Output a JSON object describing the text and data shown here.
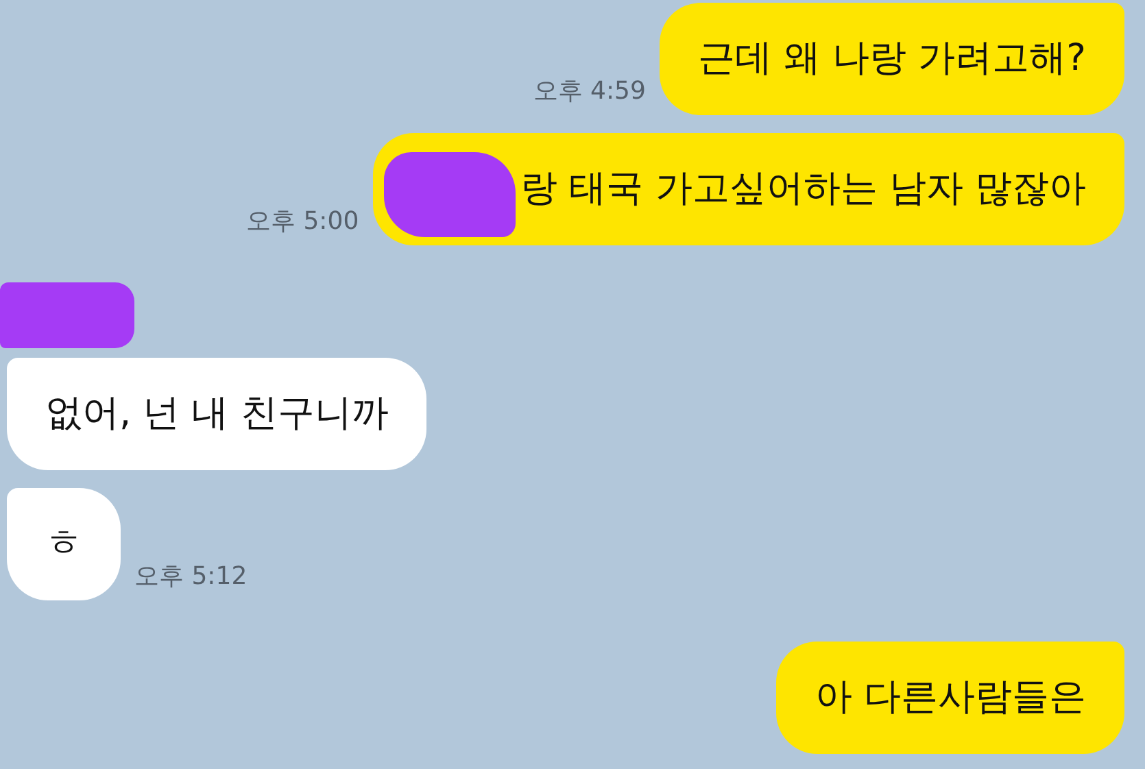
{
  "messages": [
    {
      "kind": "outgoing",
      "text": "근데 왜 나랑 가려고해?",
      "time": "오후 4:59"
    },
    {
      "kind": "outgoing",
      "text": "랑 태국 가고싶어하는 남자 많잖아",
      "time": "오후 5:00",
      "redacted": true
    },
    {
      "kind": "incoming",
      "text": "없어, 넌 내 친구니까",
      "name_hidden": true
    },
    {
      "kind": "incoming",
      "text": "ㅎ",
      "time": "오후 5:12"
    },
    {
      "kind": "outgoing",
      "text": "아 다른사람들은"
    }
  ]
}
